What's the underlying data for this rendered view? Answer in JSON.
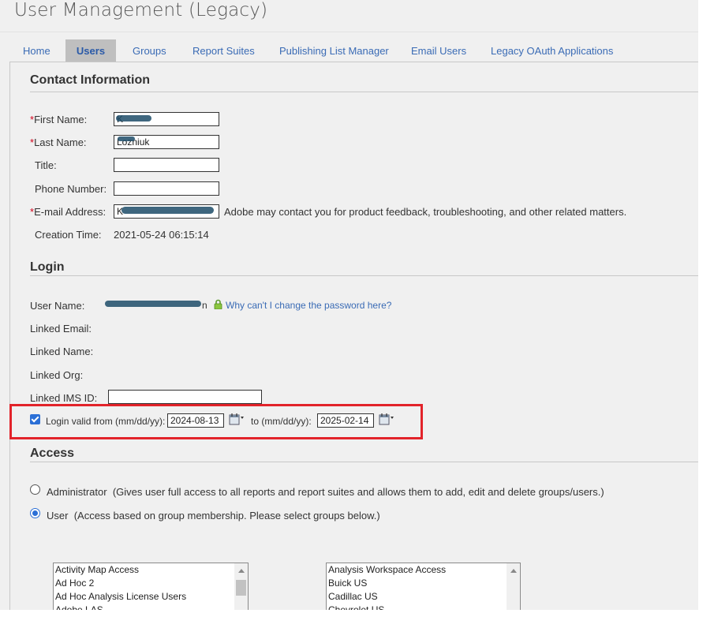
{
  "page": {
    "title": "User Management (Legacy)"
  },
  "tabs": [
    {
      "label": "Home"
    },
    {
      "label": "Users"
    },
    {
      "label": "Groups"
    },
    {
      "label": "Report Suites"
    },
    {
      "label": "Publishing List Manager"
    },
    {
      "label": "Email Users"
    },
    {
      "label": "Legacy OAuth Applications"
    }
  ],
  "contact": {
    "heading": "Contact Information",
    "required_mark": "*",
    "first_name": {
      "label": "First Name:",
      "value": "K"
    },
    "last_name": {
      "label": "Last Name:",
      "value": "Lozniuk"
    },
    "title": {
      "label": "Title:",
      "value": ""
    },
    "phone": {
      "label": "Phone Number:",
      "value": ""
    },
    "email": {
      "label": "E-mail Address:",
      "value": "K",
      "note": "Adobe may contact you for product feedback, troubleshooting, and other related matters."
    },
    "creation": {
      "label": "Creation Time:",
      "value": "2021-05-24 06:15:14"
    }
  },
  "login": {
    "heading": "Login",
    "user_name_label": "User Name:",
    "user_name_suffix": "n",
    "password_help": "Why can't I change the password here?",
    "linked_email_label": "Linked Email:",
    "linked_name_label": "Linked Name:",
    "linked_org_label": "Linked Org:",
    "linked_ims_label": "Linked IMS ID:",
    "linked_ims_value": "",
    "valid_checked": true,
    "valid_from_label": "Login valid from (mm/dd/yy):",
    "valid_from": "2024-08-13",
    "valid_to_label": "to (mm/dd/yy):",
    "valid_to": "2025-02-14"
  },
  "access": {
    "heading": "Access",
    "admin": {
      "label": "Administrator",
      "desc": "(Gives user full access to all reports and report suites and allows them to add, edit and delete groups/users.)",
      "selected": false
    },
    "user": {
      "label": "User",
      "desc": "(Access based on group membership. Please select groups below.)",
      "selected": true
    },
    "available_groups": [
      "Activity Map Access",
      "Ad Hoc 2",
      "Ad Hoc Analysis License Users",
      "Adobe LAS"
    ],
    "selected_groups": [
      "Analysis Workspace Access",
      "Buick US",
      "Cadillac US",
      "Chevrolet US"
    ]
  },
  "colors": {
    "accent": "#2b6fd6",
    "link": "#3a6bb5",
    "required": "#d0021b",
    "highlight": "#e2232a"
  },
  "icons": [
    "lock-icon",
    "calendar-icon",
    "chevron-down-icon",
    "chevron-up-icon"
  ]
}
